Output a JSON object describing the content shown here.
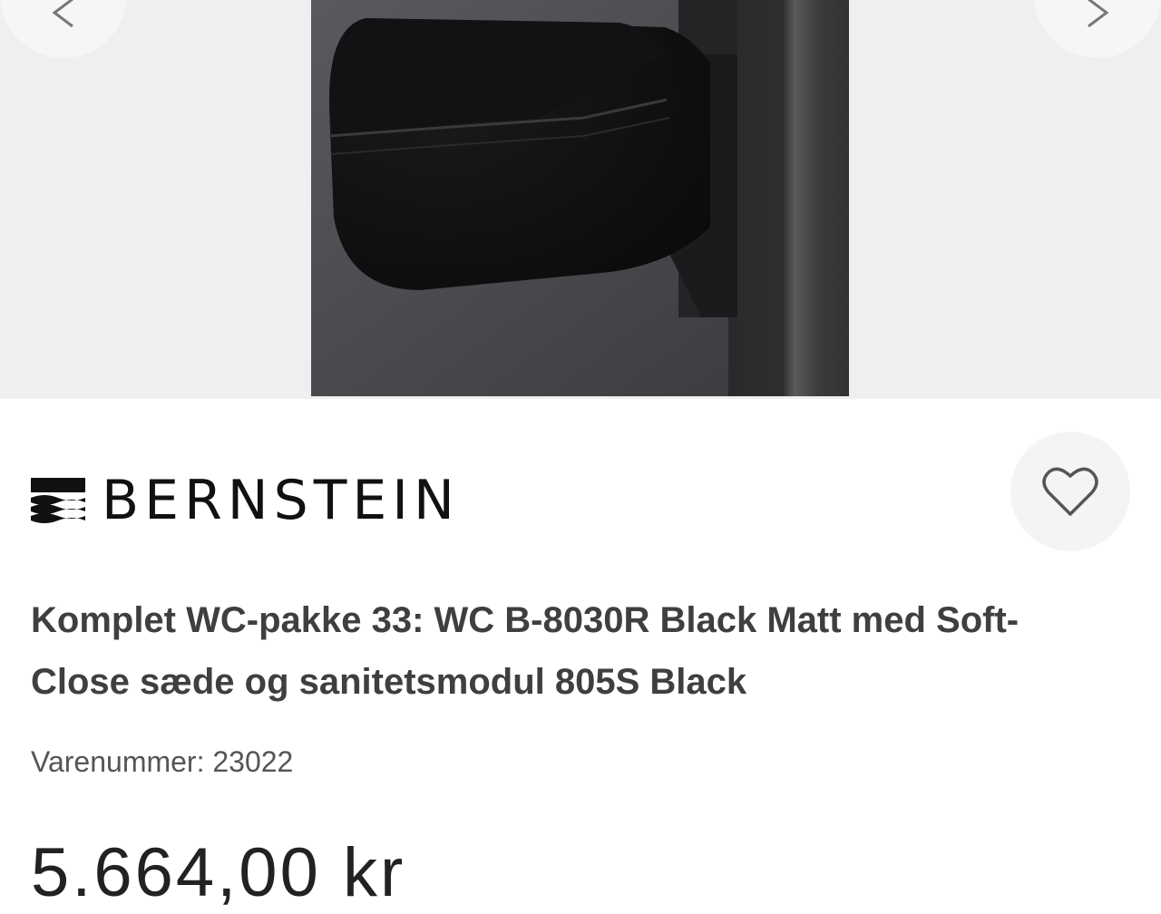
{
  "gallery": {
    "image_description_icon": "wall-hung-toilet-photo",
    "prev_icon": "chevron-left-icon",
    "next_icon": "chevron-right-icon"
  },
  "brand": {
    "name": "BERNSTEIN",
    "logo_icon": "wave-lines-icon"
  },
  "favorite": {
    "icon": "heart-icon"
  },
  "product": {
    "title": "Komplet WC-pakke 33: WC B-8030R Black Matt med Soft-Close sæde og sanitetsmodul 805S Black",
    "sku": "Varenummer: 23022",
    "price": "5.664,00 kr"
  },
  "colors": {
    "background": "#ffffff",
    "gallery_bg": "#efefef",
    "title": "#3f3f3f"
  }
}
